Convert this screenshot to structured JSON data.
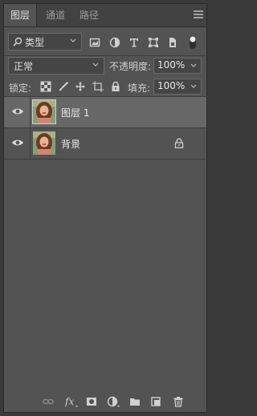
{
  "tabs": [
    {
      "label": "图层",
      "active": true
    },
    {
      "label": "通道",
      "active": false
    },
    {
      "label": "路径",
      "active": false
    }
  ],
  "filter": {
    "kind_label": "类型",
    "icons": [
      "pixel-filter-icon",
      "adjustment-filter-icon",
      "type-filter-icon",
      "shape-filter-icon",
      "smart-object-filter-icon",
      "filter-toggle-icon"
    ]
  },
  "blend_mode": "正常",
  "opacity": {
    "label": "不透明度:",
    "value": "100%"
  },
  "lock": {
    "label": "锁定:",
    "icons": [
      "lock-transparent-pixels-icon",
      "lock-image-pixels-icon",
      "lock-position-icon",
      "lock-artboard-icon",
      "lock-all-icon"
    ]
  },
  "fill": {
    "label": "填充:",
    "value": "100%"
  },
  "layers": [
    {
      "name": "图层 1",
      "selected": true,
      "locked": false,
      "visible": true
    },
    {
      "name": "背景",
      "selected": false,
      "locked": true,
      "visible": true
    }
  ],
  "footer_icons": [
    "link-layers-icon",
    "fx-icon",
    "add-mask-icon",
    "new-adjustment-layer-icon",
    "new-group-icon",
    "new-layer-icon",
    "delete-layer-icon"
  ],
  "colors": {
    "panel": "#535353",
    "selected_row": "#676767",
    "tab_bar": "#424242"
  }
}
